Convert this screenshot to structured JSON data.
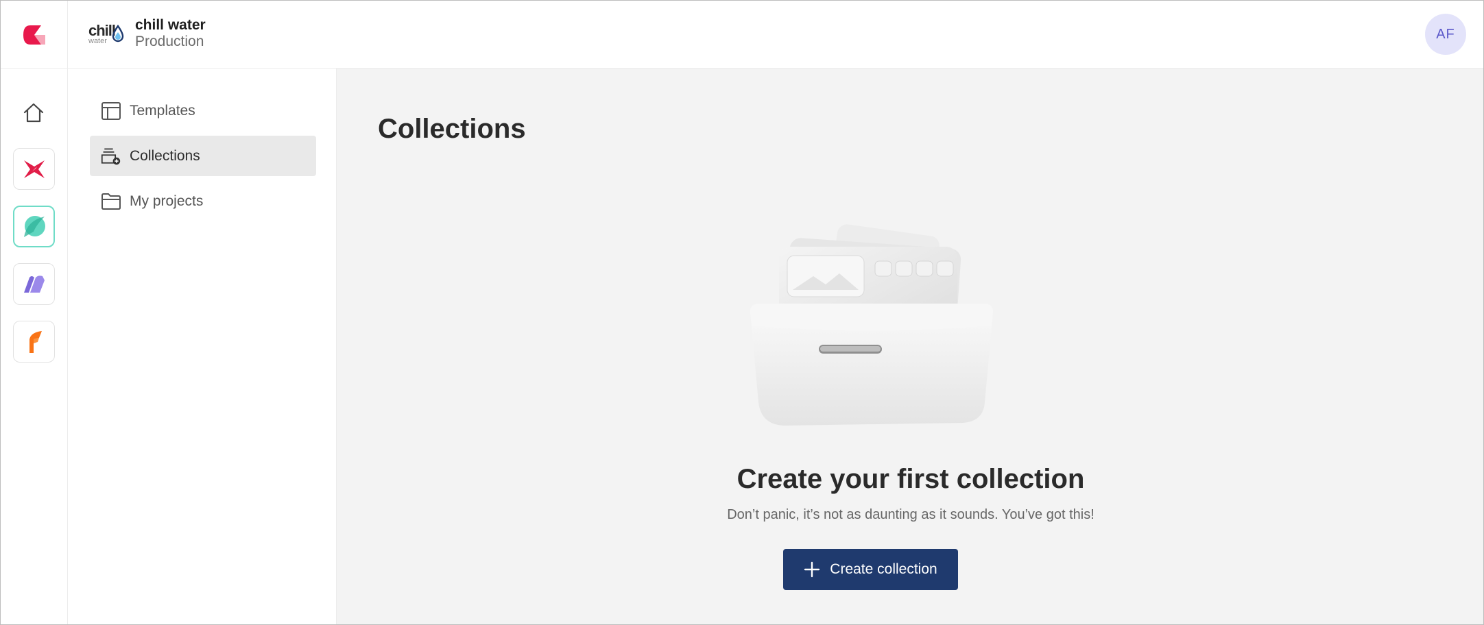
{
  "header": {
    "logo_text": "chill",
    "logo_subtext": "water",
    "workspace_name": "chill water",
    "environment": "Production",
    "avatar_initials": "AF"
  },
  "rail": {
    "items": [
      {
        "icon": "home-icon"
      },
      {
        "icon": "pink-star-app-icon",
        "color": "#e11d48"
      },
      {
        "icon": "teal-leaf-app-icon",
        "color": "#5fd6bf",
        "active": true
      },
      {
        "icon": "purple-book-app-icon",
        "color": "#7b68d9"
      },
      {
        "icon": "orange-flame-app-icon",
        "color": "#f97316"
      }
    ]
  },
  "subnav": {
    "items": [
      {
        "label": "Templates",
        "icon": "template-icon"
      },
      {
        "label": "Collections",
        "icon": "collections-icon",
        "active": true
      },
      {
        "label": "My projects",
        "icon": "folder-icon"
      }
    ]
  },
  "main": {
    "title": "Collections",
    "empty_state": {
      "title": "Create your first collection",
      "subtitle": "Don’t panic, it’s not as daunting as it sounds. You’ve got this!",
      "button_label": "Create collection"
    }
  },
  "colors": {
    "brand_red": "#e8194c",
    "primary_button": "#1f3a6e",
    "avatar_bg": "#e3e3fa",
    "avatar_text": "#5b58c9",
    "main_bg": "#f3f3f3"
  }
}
